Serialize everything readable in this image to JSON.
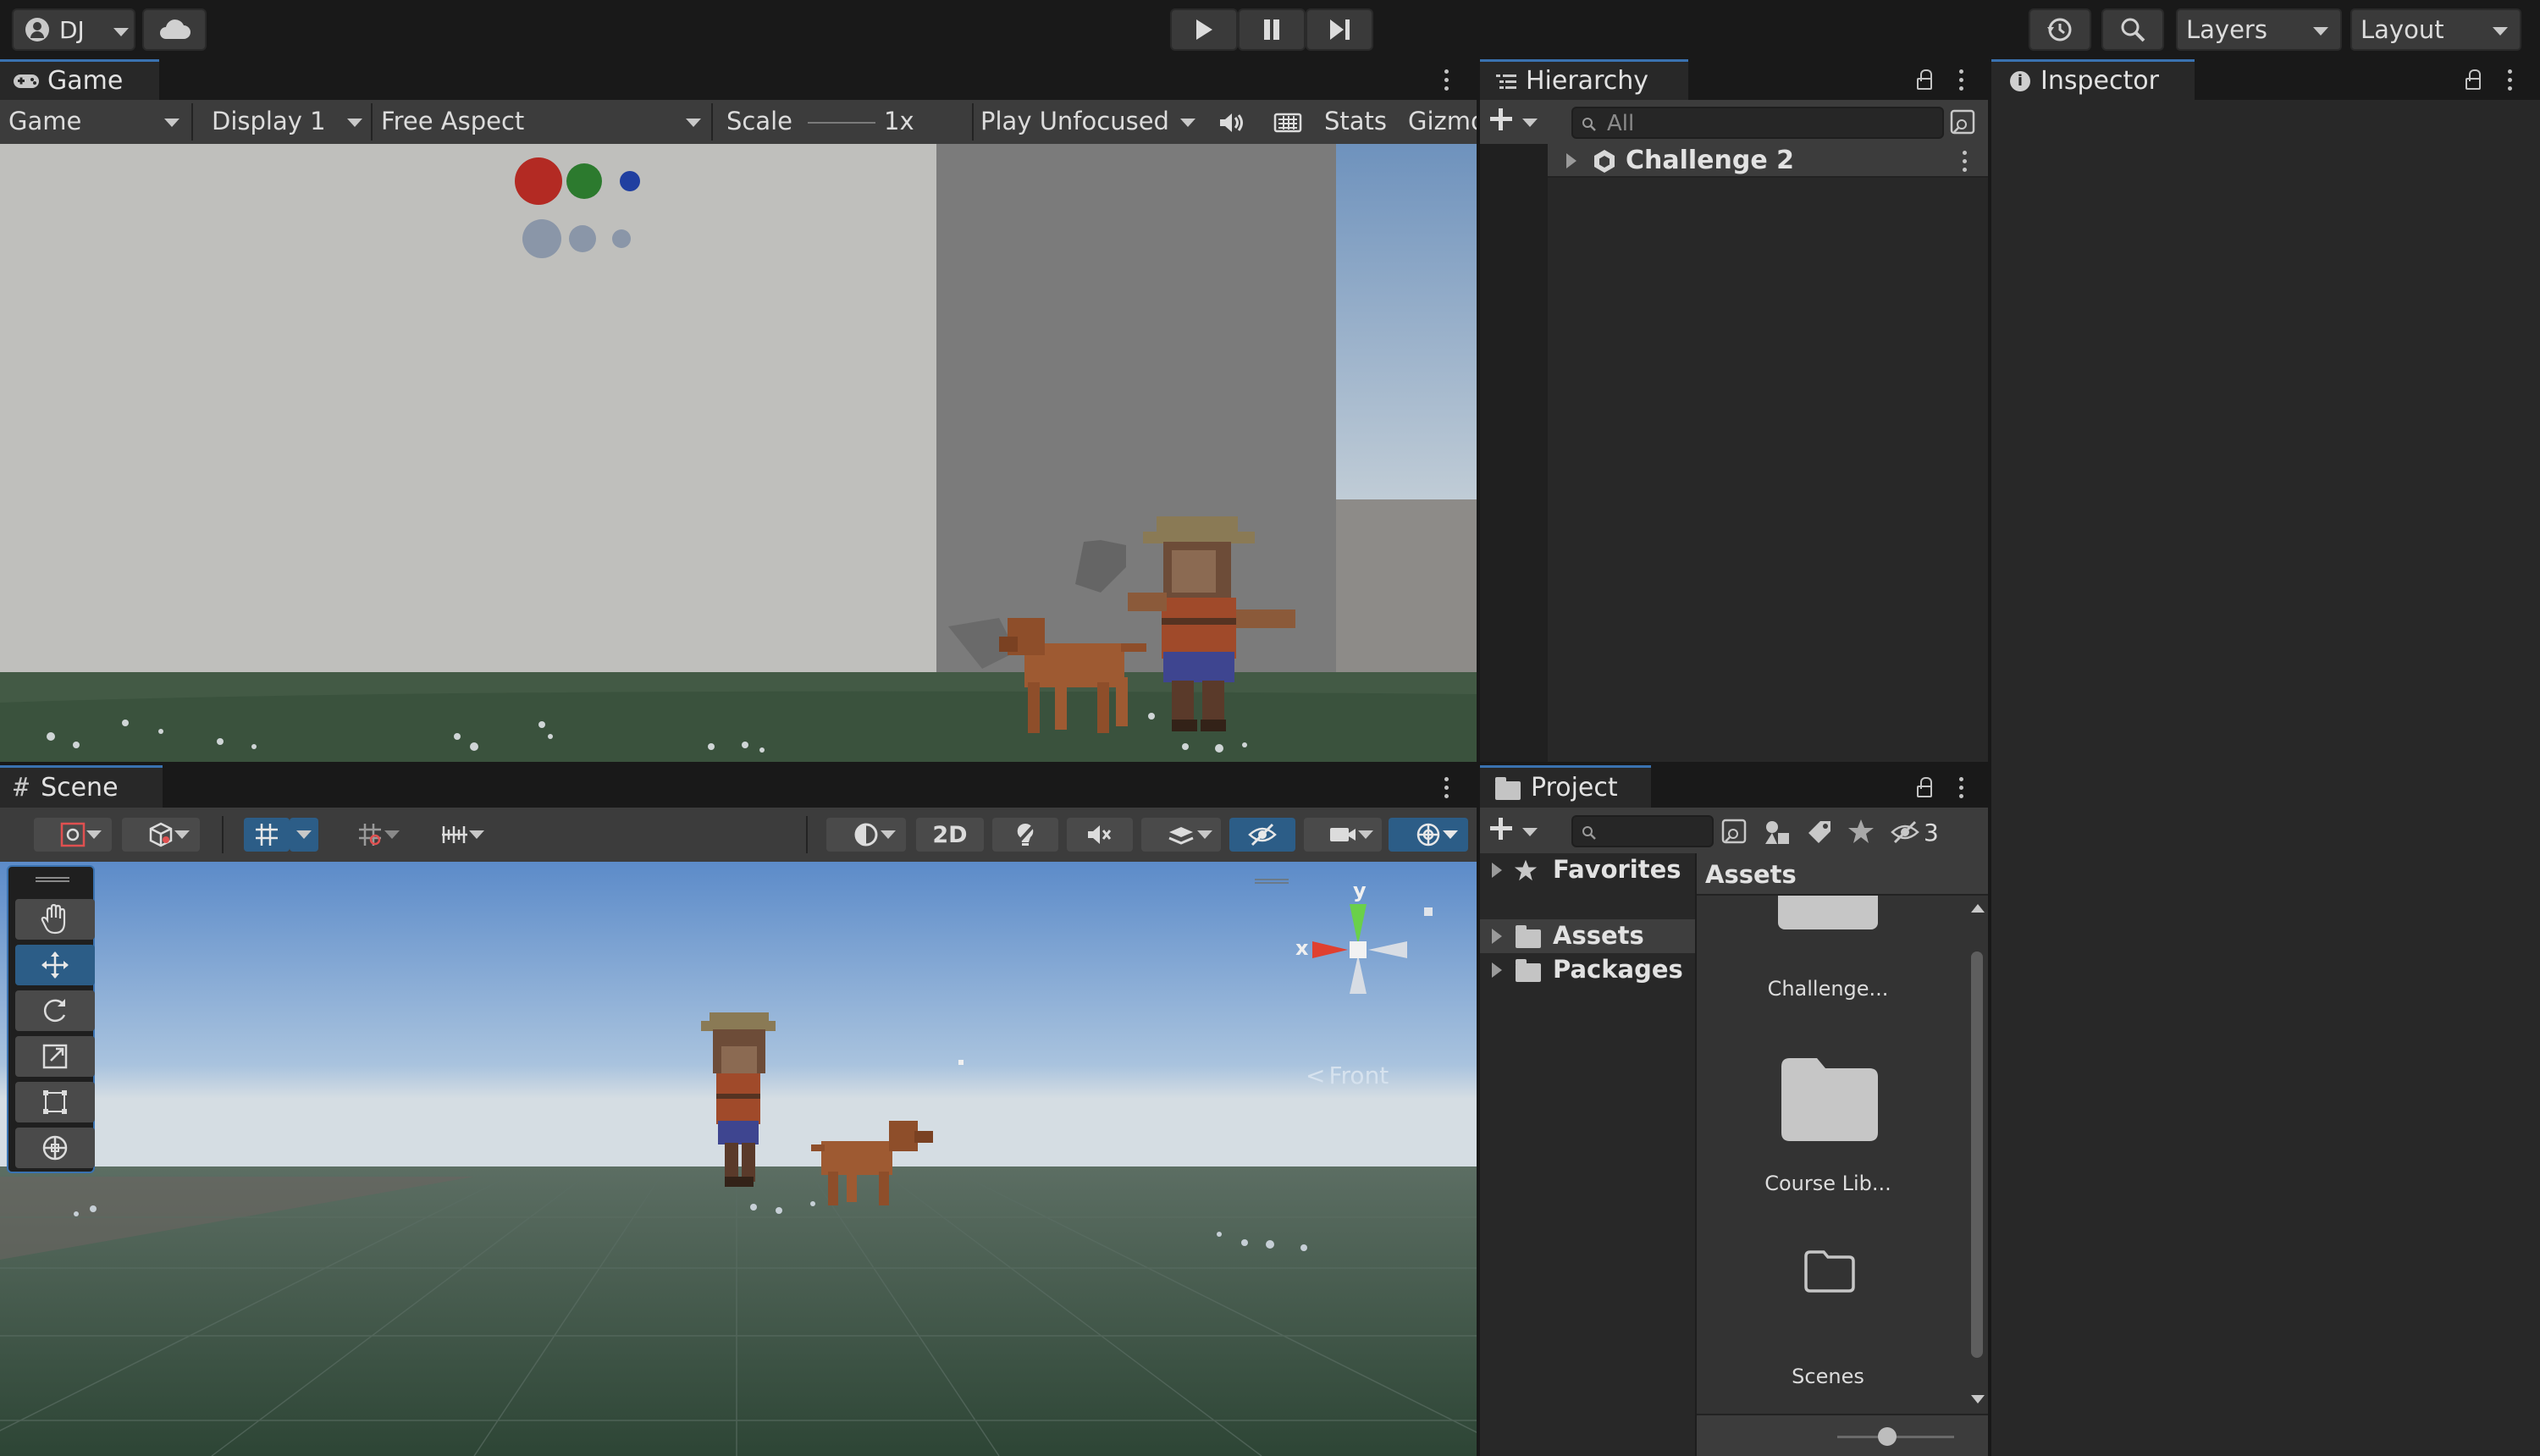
{
  "toolbar": {
    "account_label": "DJ",
    "layers_label": "Layers",
    "layout_label": "Layout"
  },
  "game": {
    "tab_label": "Game",
    "mode_dropdown": "Game",
    "display_dropdown": "Display 1",
    "aspect_dropdown": "Free Aspect",
    "scale_label": "Scale",
    "scale_value": "1x",
    "play_mode_dropdown": "Play Unfocused",
    "stats_label": "Stats",
    "gizmos_label": "Gizmos"
  },
  "hierarchy": {
    "tab_label": "Hierarchy",
    "search_placeholder": "All",
    "scene_name": "Challenge 2"
  },
  "inspector": {
    "tab_label": "Inspector"
  },
  "scene": {
    "tab_label": "Scene",
    "btn_2d": "2D",
    "gizmo_y": "y",
    "gizmo_x": "x",
    "gizmo_view": "Front"
  },
  "project": {
    "tab_label": "Project",
    "hidden_count": "3",
    "tree": {
      "favorites": "Favorites",
      "assets": "Assets",
      "packages": "Packages"
    },
    "breadcrumb": "Assets",
    "items": [
      {
        "label": "Challenge..."
      },
      {
        "label": "Course Lib..."
      },
      {
        "label": "Scenes"
      }
    ]
  },
  "colors": {
    "accent": "#3a72b0",
    "panel": "#282828",
    "toolbar": "#3c3c3c"
  }
}
